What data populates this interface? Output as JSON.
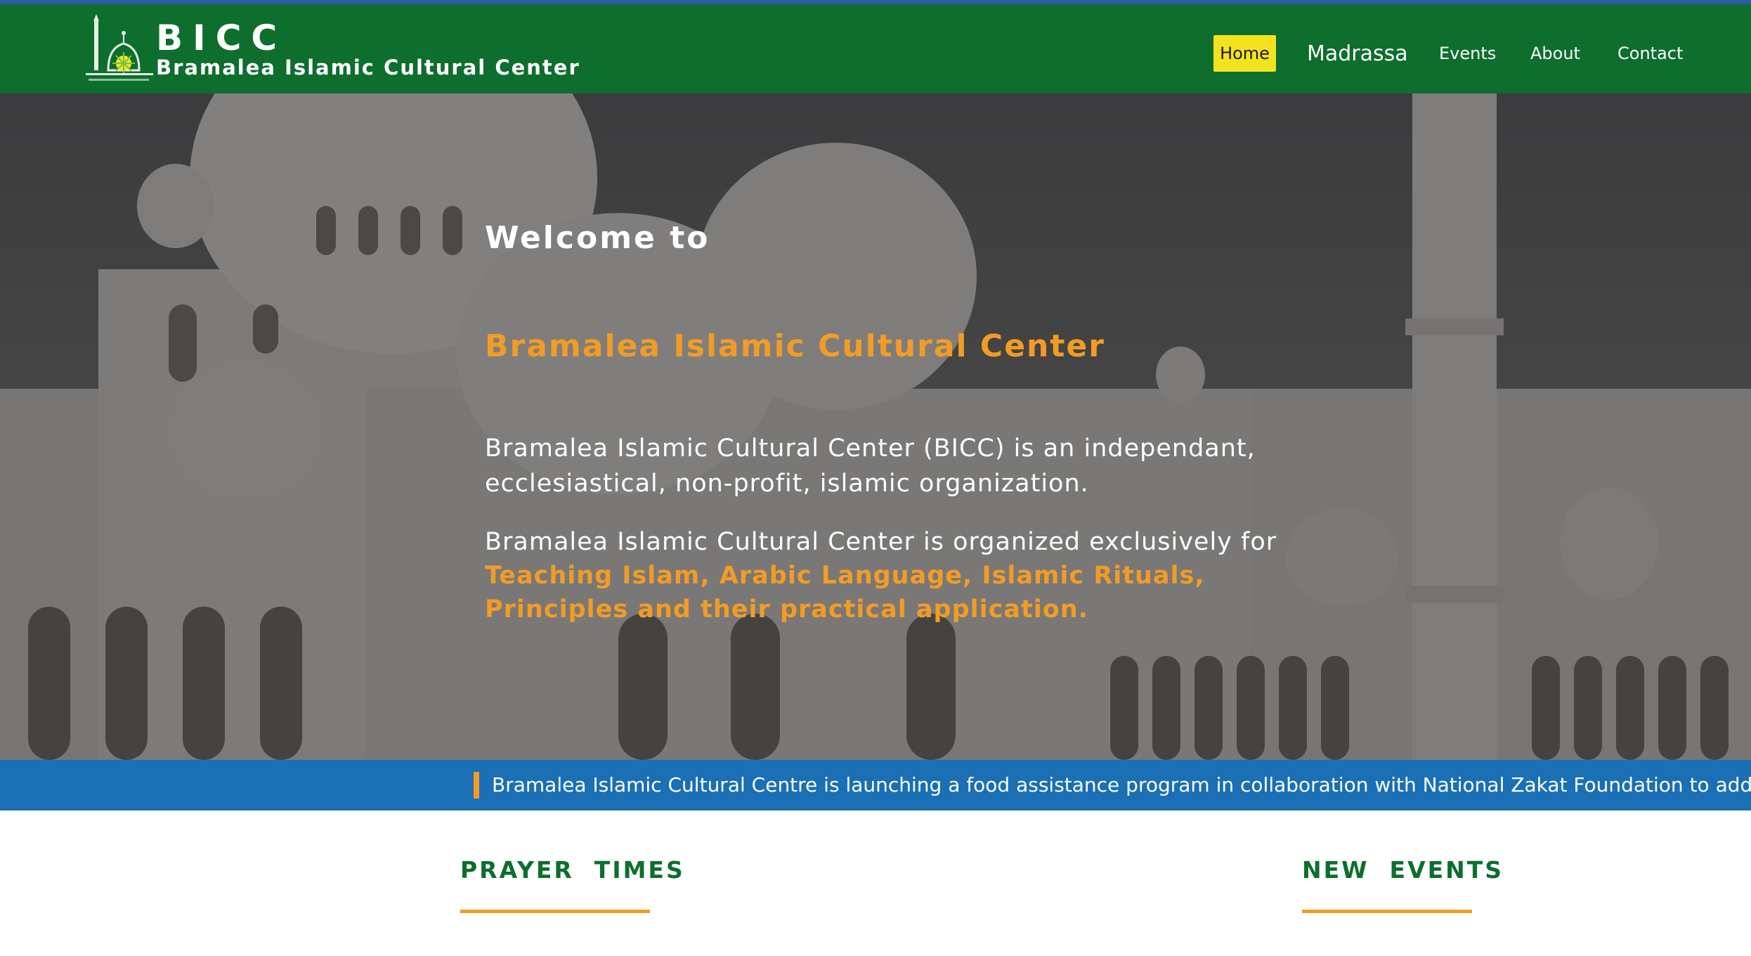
{
  "header": {
    "brand_abbr": "BICC",
    "brand_full": "Bramalea Islamic Cultural Center",
    "colors": {
      "bar": "#0d6e2e",
      "topline": "#2a5da3",
      "active_nav": "#f3e31f"
    }
  },
  "nav": {
    "items": [
      {
        "label": "Home",
        "active": true
      },
      {
        "label": "Madrassa"
      },
      {
        "label": "Events"
      },
      {
        "label": "About"
      },
      {
        "label": "Contact"
      }
    ]
  },
  "hero": {
    "welcome": "Welcome to",
    "center_name": "Bramalea Islamic Cultural Center",
    "description_1": "Bramalea Islamic Cultural Center (BICC) is an independant, ecclesiastical, non-profit, islamic organization.",
    "description_2_prefix": "Bramalea Islamic Cultural Center is organized exclusively for ",
    "description_2_highlight": "Teaching Islam, Arabic Language, Islamic Rituals, Principles and their practical application.",
    "accent_color": "#f29c26"
  },
  "ticker": {
    "text": "Bramalea Islamic Cultural Centre is launching a food assistance program in collaboration with National Zakat Foundation to address",
    "color": "#1a6fb5"
  },
  "sections": {
    "prayer_title": "PRAYER  TIMES",
    "events_title": "NEW  EVENTS"
  }
}
